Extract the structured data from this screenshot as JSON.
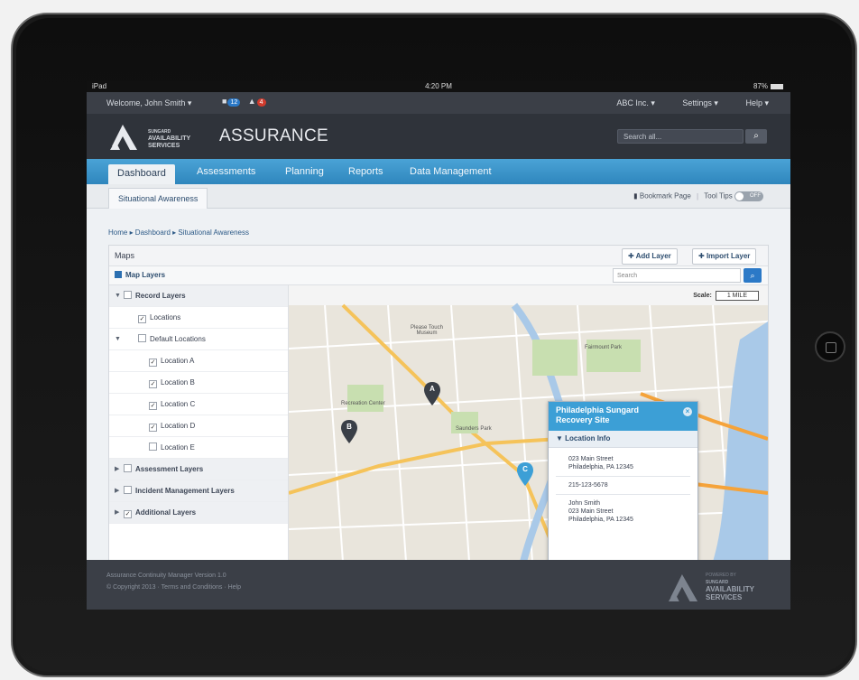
{
  "status_bar": {
    "device": "iPad",
    "time": "4:20 PM",
    "battery": "87%"
  },
  "top_bar": {
    "welcome": "Welcome, John Smith",
    "messages_count": "12",
    "alerts_count": "4",
    "company": "ABC Inc.",
    "settings": "Settings",
    "help": "Help"
  },
  "header": {
    "logo_small": "SUNGARD",
    "logo_line1": "AVAILABILITY",
    "logo_line2": "SERVICES",
    "app_title": "ASSURANCE",
    "search_placeholder": "Search all..."
  },
  "nav": {
    "tabs": [
      {
        "label": "Dashboard",
        "active": true
      },
      {
        "label": "Assessments"
      },
      {
        "label": "Planning"
      },
      {
        "label": "Reports"
      },
      {
        "label": "Data Management"
      }
    ]
  },
  "subnav": {
    "tab": "Situational Awareness",
    "bookmark": "Bookmark Page",
    "tooltips": "Tool Tips",
    "tooltips_state": "OFF"
  },
  "breadcrumb": "Home ▸ Dashboard ▸ Situational Awareness",
  "maps_panel": {
    "title": "Maps",
    "add_layer": "Add Layer",
    "import_layer": "Import Layer",
    "map_layers_label": "Map Layers",
    "search_placeholder": "Search",
    "scale_label": "Scale:",
    "scale_value": "1 MILE"
  },
  "layers": {
    "record_layers": "Record Layers",
    "locations": "Locations",
    "default_locations": "Default Locations",
    "location_a": "Location A",
    "location_b": "Location B",
    "location_c": "Location C",
    "location_d": "Location D",
    "location_e": "Location E",
    "assessment_layers": "Assessment Layers",
    "incident_layers": "Incident Management Layers",
    "additional_layers": "Additional Layers"
  },
  "map": {
    "label_museum": "Please Touch Museum",
    "label_fairmount": "Fairmount Park",
    "label_saunders": "Saunders Park",
    "label_recreation": "Recreation Center",
    "pin_a": "A",
    "pin_b": "B",
    "pin_c": "C"
  },
  "popup": {
    "title": "Philadelphia Sungard Recovery Site",
    "section": "Location Info",
    "address_line1": "023 Main Street",
    "address_line2": "Philadelphia, PA 12345",
    "phone": "215-123-5678",
    "contact_name": "John Smith",
    "contact_line1": "023 Main Street",
    "contact_line2": "Philadelphia, PA 12345"
  },
  "footer": {
    "version": "Assurance Continuity Manager Version 1.0",
    "copyright": "© Copyright 2013 · Terms and Conditions · Help",
    "powered": "POWERED BY",
    "brand_small": "SUNGARD",
    "brand_line1": "AVAILABILITY",
    "brand_line2": "SERVICES"
  }
}
